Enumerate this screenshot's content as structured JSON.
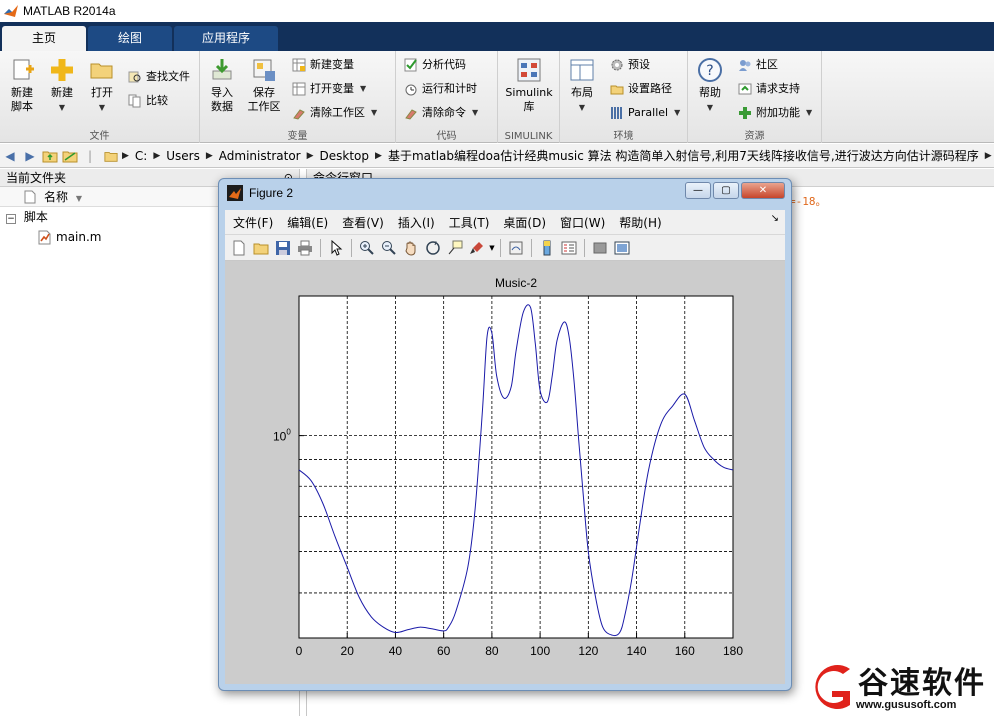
{
  "app": {
    "title": "MATLAB R2014a"
  },
  "tabs": [
    {
      "label": "主页",
      "active": true
    },
    {
      "label": "绘图",
      "active": false
    },
    {
      "label": "应用程序",
      "active": false
    }
  ],
  "ribbon": {
    "file_group": {
      "label": "文件",
      "new_script": "新建\n脚本",
      "new": "新建",
      "open": "打开",
      "find_files": "查找文件",
      "compare": "比较"
    },
    "variable_group": {
      "label": "变量",
      "import_data": "导入\n数据",
      "save_workspace": "保存\n工作区",
      "new_variable": "新建变量",
      "open_variable": "打开变量",
      "clear_workspace": "清除工作区"
    },
    "code_group": {
      "label": "代码",
      "analyze_code": "分析代码",
      "run_and_time": "运行和计时",
      "clear_commands": "清除命令"
    },
    "simulink_group": {
      "label": "SIMULINK",
      "simulink": "Simulink\n库"
    },
    "env_group": {
      "label": "环境",
      "layout": "布局",
      "preferences": "预设",
      "set_path": "设置路径",
      "parallel": "Parallel"
    },
    "resources_group": {
      "label": "资源",
      "help": "帮助",
      "community": "社区",
      "request_support": "请求支持",
      "addons": "附加功能"
    }
  },
  "address": {
    "segments": [
      "C:",
      "Users",
      "Administrator",
      "Desktop",
      "基于matlab编程doa估计经典music 算法 构造简单入射信号,利用7天线阵接收信号,进行波达方向估计源码程序"
    ]
  },
  "file_panel": {
    "header": "当前文件夹",
    "column_name": "名称",
    "folder": "脚本",
    "file": "main.m"
  },
  "command_window": {
    "header": "命令行窗口",
    "warning_fragment": "=-18。"
  },
  "figure": {
    "title": "Figure 2",
    "menu": [
      "文件(F)",
      "编辑(E)",
      "查看(V)",
      "插入(I)",
      "工具(T)",
      "桌面(D)",
      "窗口(W)",
      "帮助(H)"
    ],
    "toolbar_icons": [
      "new-figure-icon",
      "open-file-icon",
      "save-icon",
      "print-icon",
      "pointer-icon",
      "zoom-in-icon",
      "zoom-out-icon",
      "pan-icon",
      "rotate-3d-icon",
      "data-cursor-icon",
      "brush-icon",
      "link-plot-icon",
      "colorbar-icon",
      "legend-icon",
      "hide-plot-tools-icon",
      "show-plot-tools-icon"
    ]
  },
  "chart_data": {
    "type": "line",
    "title": "Music-2",
    "xlabel": "",
    "ylabel": "",
    "xlim": [
      0,
      180
    ],
    "yscale": "log",
    "ylim": [
      0.41,
      1.85
    ],
    "x_ticks": [
      0,
      20,
      40,
      60,
      80,
      100,
      120,
      140,
      160,
      180
    ],
    "y_tick_label": "10^0",
    "grid": true,
    "line_color": "#1a1aa8",
    "x": [
      0,
      5,
      10,
      15,
      20,
      25,
      30,
      35,
      40,
      45,
      50,
      55,
      60,
      62,
      65,
      70,
      73,
      76,
      78,
      80,
      82,
      85,
      88,
      90,
      93,
      96,
      98,
      100,
      103,
      105,
      107,
      110,
      112,
      114,
      116,
      118,
      120,
      123,
      126,
      130,
      133,
      135,
      138,
      141,
      145,
      150,
      155,
      160,
      164,
      168,
      172,
      176,
      180
    ],
    "y": [
      0.86,
      0.82,
      0.74,
      0.64,
      0.56,
      0.49,
      0.45,
      0.43,
      0.42,
      0.425,
      0.43,
      0.427,
      0.423,
      0.43,
      0.46,
      0.56,
      0.72,
      1.1,
      1.55,
      1.57,
      1.3,
      1.18,
      1.24,
      1.45,
      1.72,
      1.76,
      1.5,
      1.22,
      1.16,
      1.3,
      1.52,
      1.65,
      1.55,
      1.28,
      0.98,
      0.76,
      0.6,
      0.49,
      0.43,
      0.415,
      0.42,
      0.45,
      0.53,
      0.66,
      0.86,
      1.05,
      1.14,
      1.2,
      1.07,
      0.95,
      0.9,
      0.87,
      0.86
    ]
  },
  "watermark": {
    "name": "谷速软件",
    "url": "www.gususoft.com"
  }
}
